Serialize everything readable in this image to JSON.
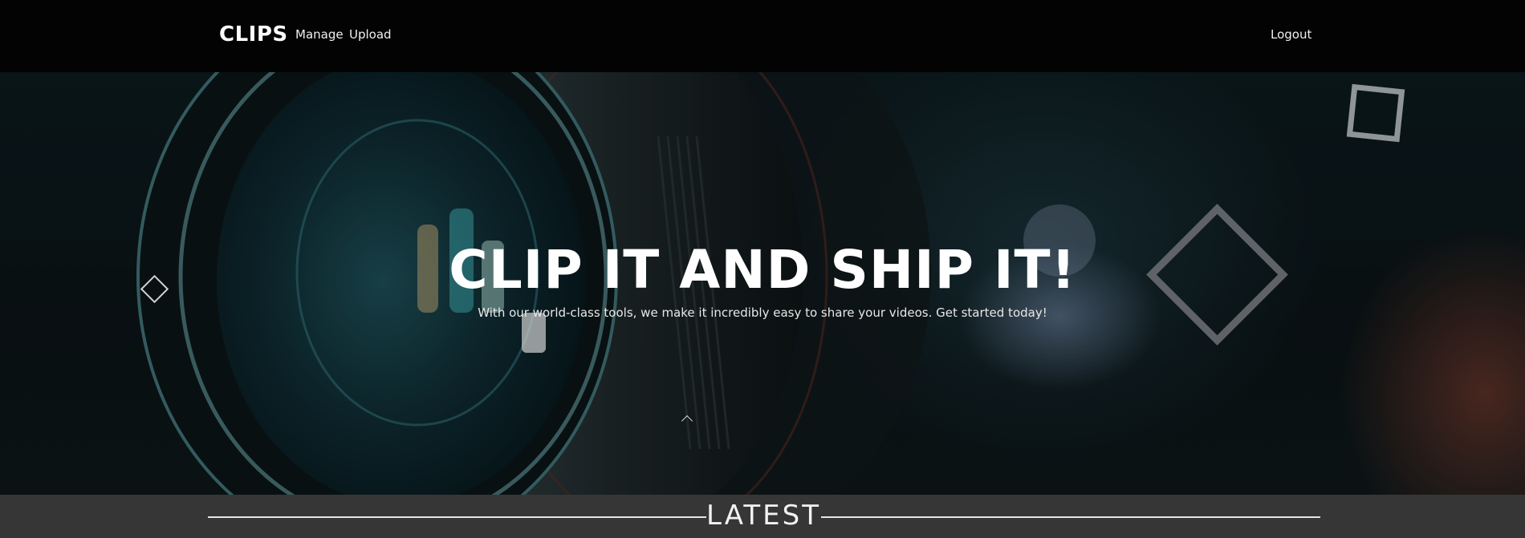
{
  "header": {
    "brand": "CLIPS",
    "nav": {
      "manage": "Manage",
      "upload": "Upload",
      "logout": "Logout"
    }
  },
  "hero": {
    "title": "CLIP IT AND SHIP IT!",
    "subtitle": "With our world-class tools, we make it incredibly easy to share your videos. Get started today!",
    "background_image": "camera-lens-photo",
    "decorations": [
      "diamond-outline-icon",
      "square-outline-icon",
      "diamond-outline-icon",
      "caret-up-icon"
    ]
  },
  "latest": {
    "title": "LATEST"
  },
  "colors": {
    "header_bg": "#030303",
    "band_bg": "#363636",
    "text": "#ffffff"
  }
}
